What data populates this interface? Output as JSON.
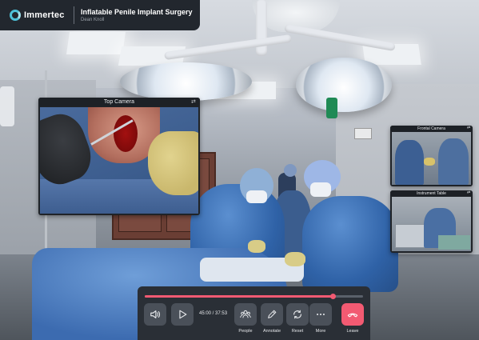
{
  "brand": {
    "name": "Immertec",
    "icon": "immertec-logo-icon"
  },
  "session": {
    "title": "Inflatable Penile Implant Surgery",
    "presenter": "Dean Knoll"
  },
  "cameras": [
    {
      "label": "Top Camera",
      "icon": "expand-icon"
    },
    {
      "label": "Frontal Camera",
      "icon": "expand-icon"
    },
    {
      "label": "Instrument Table",
      "icon": "expand-icon"
    }
  ],
  "playback": {
    "current": "45:00",
    "total": "37:53",
    "time_display": "45:00 / 37:53",
    "progress_fraction": 0.86
  },
  "controls": {
    "volume": {
      "icon": "volume-icon"
    },
    "play": {
      "icon": "play-icon"
    },
    "people": {
      "label": "People",
      "icon": "people-icon"
    },
    "annotate": {
      "label": "Annotate",
      "icon": "pencil-icon"
    },
    "reset": {
      "label": "Reset",
      "icon": "reset-icon"
    },
    "more": {
      "label": "More",
      "icon": "more-icon"
    },
    "leave": {
      "label": "Leave",
      "icon": "hang-up-icon"
    }
  },
  "colors": {
    "accent": "#f25a72",
    "brand": "#4ec1d8",
    "panel": "#2a2f36",
    "button": "#4a5059"
  }
}
